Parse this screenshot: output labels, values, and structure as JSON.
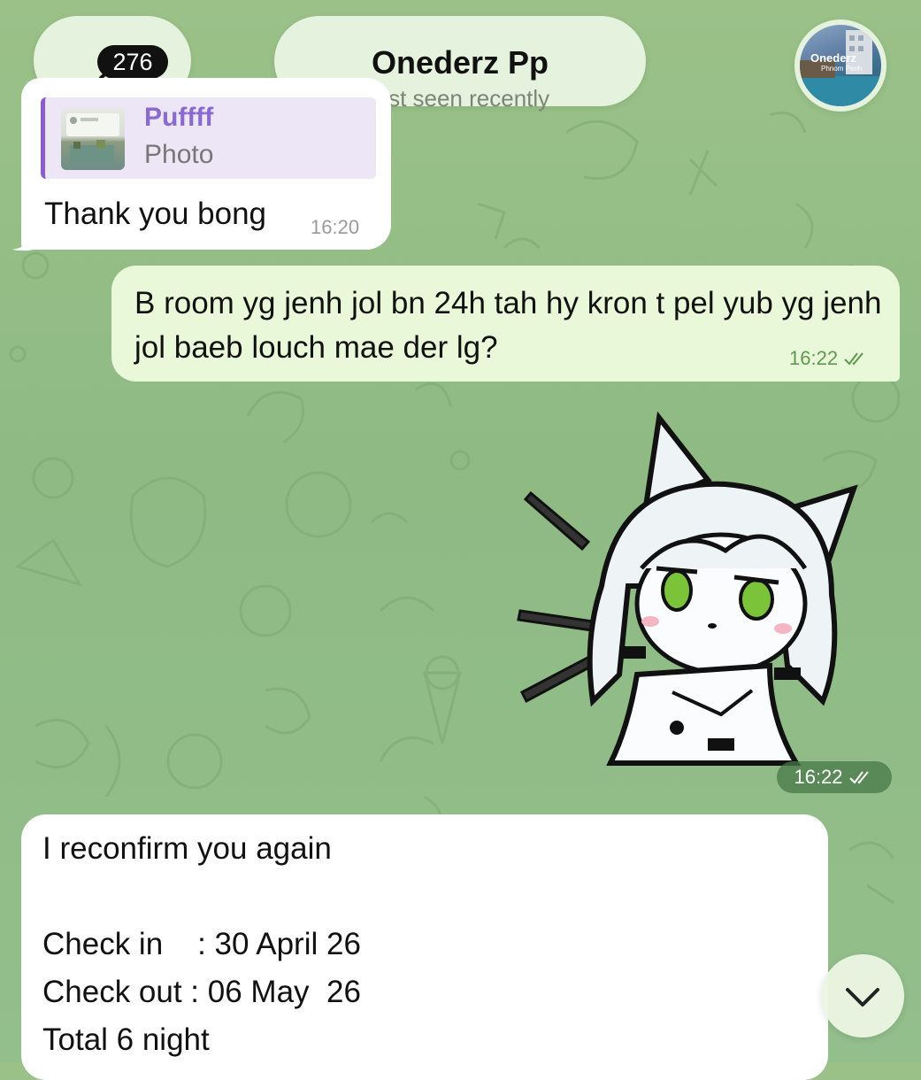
{
  "header": {
    "back_count": "276",
    "contact_name": "Onederz Pp",
    "status": "last seen recently",
    "avatar_logo": "Onederz",
    "avatar_sub": "Phnom Penh"
  },
  "messages": [
    {
      "direction": "incoming",
      "reply_to": {
        "name": "Puffff",
        "kind": "Photo"
      },
      "text": "Thank you bong",
      "time": "16:20"
    },
    {
      "direction": "outgoing",
      "text": "B room yg jenh jol bn 24h tah hy kron t pel yub yg jenh jol baeb louch mae der lg?",
      "time": "16:22",
      "read": true
    },
    {
      "direction": "outgoing",
      "sticker": "anime-cat-girl-sticker",
      "time": "16:22",
      "read": true
    },
    {
      "direction": "incoming",
      "lines": [
        "I reconfirm you again",
        "",
        "Check in    : 30 April 26",
        "Check out : 06 May  26",
        "Total 6 night"
      ]
    }
  ],
  "icons": {
    "back": "chevron-left-icon",
    "read": "double-check-icon",
    "scroll": "chevron-down-icon"
  },
  "colors": {
    "outgoing_bubble": "#e8f8d8",
    "incoming_bubble": "#ffffff",
    "reply_accent": "#8b6ad0",
    "read_check": "#5e9a4e"
  }
}
